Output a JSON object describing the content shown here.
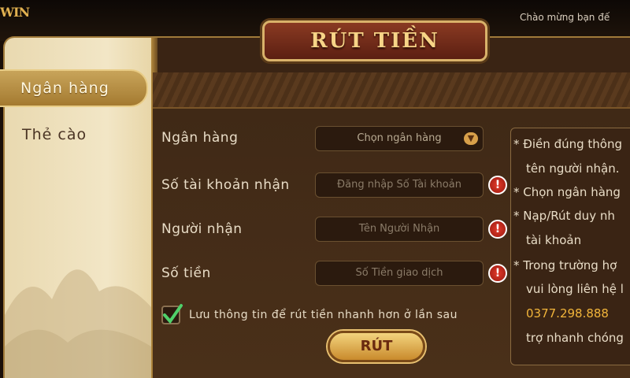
{
  "header": {
    "logo_text": "WIN",
    "welcome": "Chào mừng bạn đế",
    "title": "RÚT TIỀN"
  },
  "sidebar": {
    "items": [
      {
        "label": "Ngân hàng",
        "active": true
      },
      {
        "label": "Thẻ cào",
        "active": false
      }
    ]
  },
  "form": {
    "bank_label": "Ngân hàng",
    "bank_select_placeholder": "Chọn ngân hàng",
    "account_label": "Số tài khoản nhận",
    "account_placeholder": "Đăng nhập Số Tài khoản",
    "recipient_label": "Người nhận",
    "recipient_placeholder": "Tên Người Nhận",
    "amount_label": "Số tiền",
    "amount_placeholder": "Số Tiền giao dịch",
    "save_info_label": "Lưu thông tin để rút tiền nhanh hơn ở lần sau",
    "save_info_checked": true,
    "submit_label": "RÚT"
  },
  "notes": {
    "lines": [
      "* Điền đúng thông",
      "tên người nhận.",
      "* Chọn ngân hàng",
      "* Nạp/Rút duy nh",
      "tài khoản",
      "* Trong trường hợ",
      "vui lòng liên hệ l",
      "0377.298.888",
      "trợ nhanh chóng"
    ]
  },
  "colors": {
    "accent_gold": "#d9b26a",
    "warning_red": "#e23a2a",
    "phone_highlight": "#f2b53a"
  }
}
